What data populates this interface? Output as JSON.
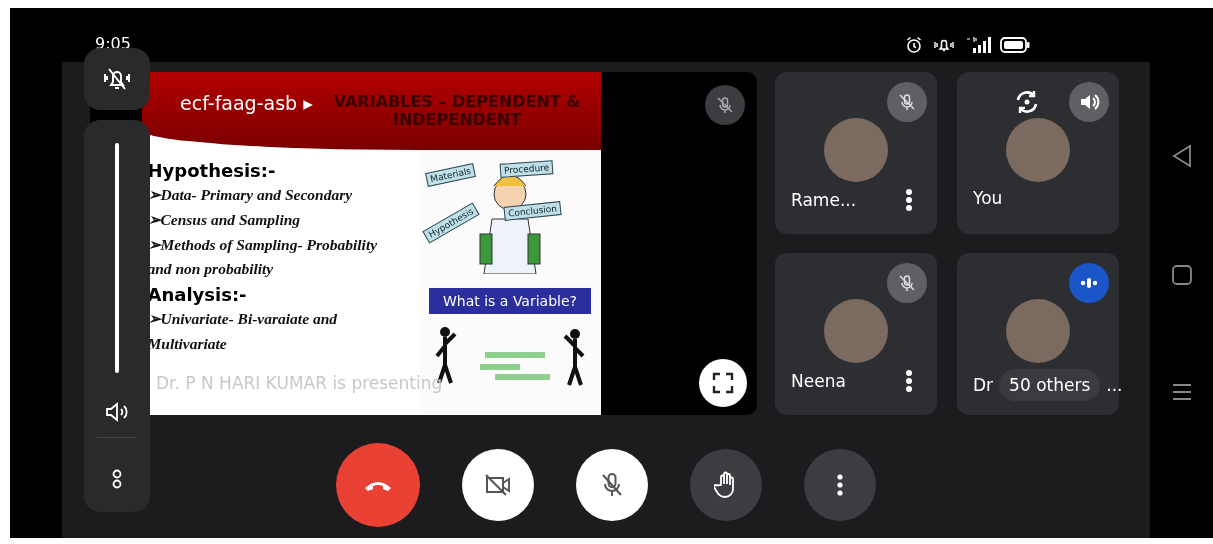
{
  "status_bar": {
    "time": "9:05"
  },
  "volume": {
    "level": 1
  },
  "presentation": {
    "meeting_code": "ecf-faag-asb",
    "code_arrow": "▸",
    "presenter": "Dr. P N HARI KUMAR is presenting",
    "muted": true,
    "slide": {
      "title": "VARIABLES – DEPENDENT & INDEPENDENT",
      "items": [
        {
          "kind": "heading",
          "lines": [
            "Hypothesis:-"
          ]
        },
        {
          "kind": "bullet",
          "lines": [
            "➢Data- Primary and Secondary"
          ]
        },
        {
          "kind": "bullet",
          "lines": [
            "➢Census and Sampling"
          ]
        },
        {
          "kind": "bullet",
          "lines": [
            "➢Methods of Sampling- Probability",
            "and non probability"
          ]
        },
        {
          "kind": "heading",
          "lines": [
            "Analysis:-"
          ]
        },
        {
          "kind": "bullet",
          "lines": [
            "➢Univariate- Bi-varaiate and",
            "Multivariate"
          ]
        }
      ],
      "diagram_labels": [
        "Materials",
        "Procedure",
        "Hypothesis",
        "Conclusion"
      ],
      "banner": "What is a Variable?"
    }
  },
  "participants": [
    {
      "name": "Rame...",
      "kind": "muted",
      "menu": true
    },
    {
      "name": "You",
      "kind": "self",
      "menu": false
    },
    {
      "name": "Neena",
      "kind": "muted",
      "menu": true
    },
    {
      "name": "Dr",
      "suffix": "...",
      "kind": "speaking",
      "others": "50 others"
    }
  ],
  "controls": [
    {
      "kind": "end"
    },
    {
      "kind": "camera-off"
    },
    {
      "kind": "mic-off"
    },
    {
      "kind": "hand"
    },
    {
      "kind": "more"
    }
  ]
}
